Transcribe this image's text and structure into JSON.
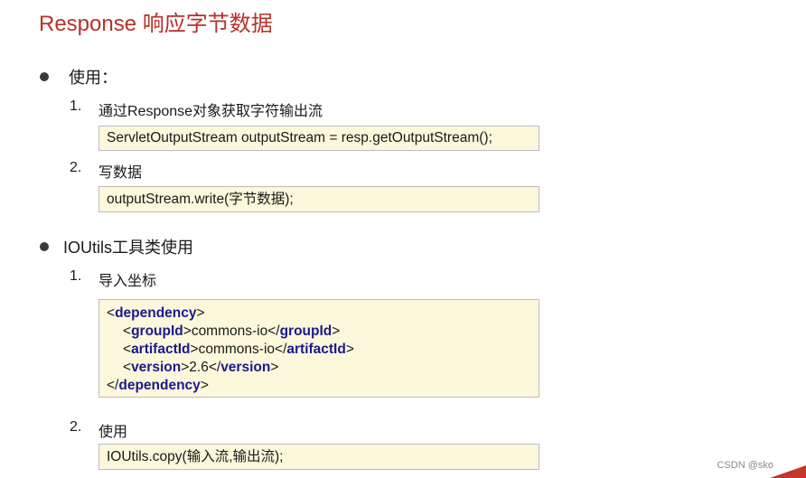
{
  "title": "Response 响应字节数据",
  "sections": [
    {
      "heading": "使用：",
      "steps": [
        {
          "num": "1.",
          "label": "通过Response对象获取字符输出流",
          "code": [
            "ServletOutputStream outputStream = resp.getOutputStream();"
          ]
        },
        {
          "num": "2.",
          "label": "写数据",
          "code": [
            "outputStream.write(字节数据);"
          ]
        }
      ]
    },
    {
      "heading": "IOUtils工具类使用",
      "steps": [
        {
          "num": "1.",
          "label": "导入坐标"
        },
        {
          "num": "2.",
          "label": "使用",
          "code": [
            "IOUtils.copy(输入流,输出流);"
          ]
        }
      ]
    }
  ],
  "xml": {
    "dependency": "dependency",
    "groupId": "groupId",
    "groupId_value": "commons-io",
    "artifactId": "artifactId",
    "artifactId_value": "commons-io",
    "version": "version",
    "version_value": "2.6"
  },
  "watermark": "CSDN @sko",
  "colors": {
    "title": "#b5322a",
    "code_bg": "#fdf7dc",
    "xml_tag": "#1a1a8c",
    "corner": "#c4352a"
  }
}
